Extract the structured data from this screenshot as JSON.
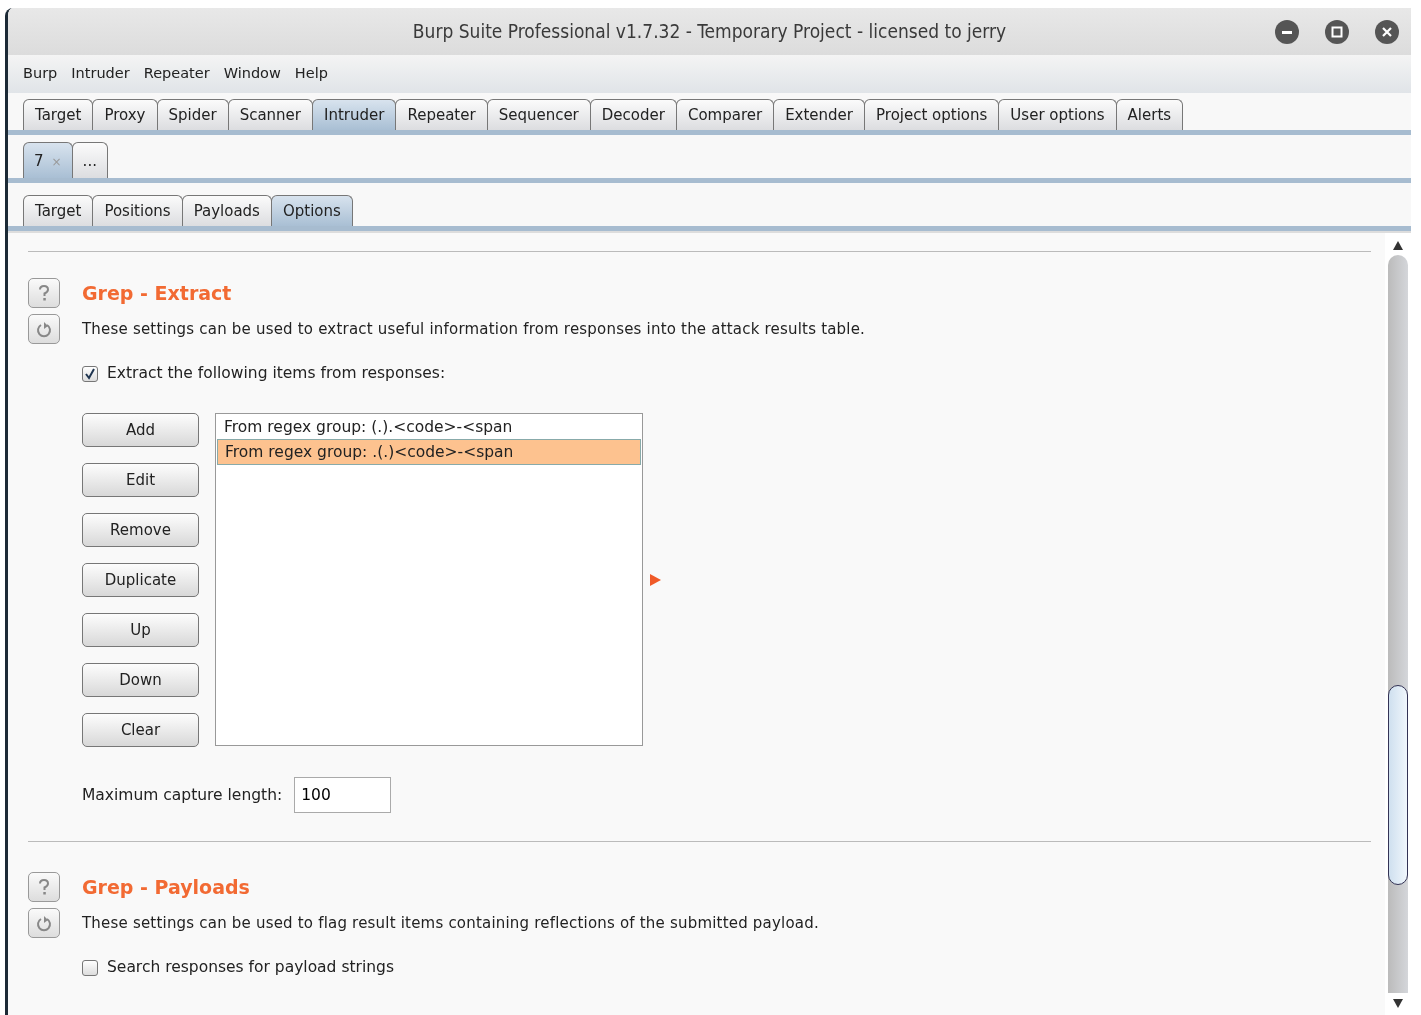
{
  "window": {
    "title": "Burp Suite Professional v1.7.32 - Temporary Project - licensed to jerry"
  },
  "menu": [
    "Burp",
    "Intruder",
    "Repeater",
    "Window",
    "Help"
  ],
  "main_tabs": [
    {
      "label": "Target",
      "selected": false
    },
    {
      "label": "Proxy",
      "selected": false
    },
    {
      "label": "Spider",
      "selected": false
    },
    {
      "label": "Scanner",
      "selected": false
    },
    {
      "label": "Intruder",
      "selected": true
    },
    {
      "label": "Repeater",
      "selected": false
    },
    {
      "label": "Sequencer",
      "selected": false
    },
    {
      "label": "Decoder",
      "selected": false
    },
    {
      "label": "Comparer",
      "selected": false
    },
    {
      "label": "Extender",
      "selected": false
    },
    {
      "label": "Project options",
      "selected": false
    },
    {
      "label": "User options",
      "selected": false
    },
    {
      "label": "Alerts",
      "selected": false
    }
  ],
  "attack_tabs": [
    {
      "label": "7",
      "close": "×",
      "selected": true
    },
    {
      "label": "...",
      "selected": false
    }
  ],
  "sub_tabs": [
    {
      "label": "Target",
      "selected": false
    },
    {
      "label": "Positions",
      "selected": false
    },
    {
      "label": "Payloads",
      "selected": false
    },
    {
      "label": "Options",
      "selected": true
    }
  ],
  "sections": [
    {
      "title": "Grep - Extract",
      "description": "These settings can be used to extract useful information from responses into the attack results table.",
      "options": [
        {
          "label": "Extract the following items from responses:",
          "checked": true
        }
      ],
      "extract": {
        "buttons": [
          "Add",
          "Edit",
          "Remove",
          "Duplicate",
          "Up",
          "Down",
          "Clear"
        ],
        "items": [
          {
            "text": "From regex group: (.).<code>-<span",
            "selected": false
          },
          {
            "text": "From regex group: .(.)<code>-<span",
            "selected": true
          }
        ],
        "max_capture": {
          "label": "Maximum capture length:",
          "value": "100"
        }
      }
    },
    {
      "title": "Grep - Payloads",
      "description": "These settings can be used to flag result items containing reflections of the submitted payload.",
      "options": [
        {
          "label": "Search responses for payload strings",
          "checked": false
        }
      ]
    }
  ]
}
